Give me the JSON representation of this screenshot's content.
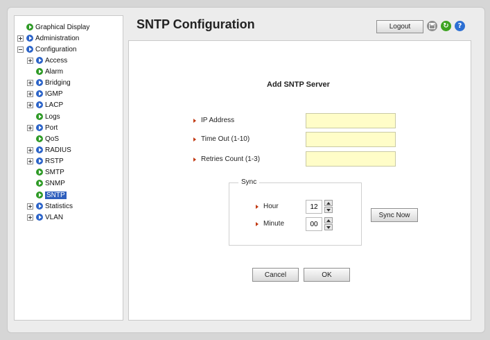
{
  "page": {
    "title": "SNTP Configuration"
  },
  "header": {
    "logout_label": "Logout",
    "icons": [
      "save-icon",
      "refresh-icon",
      "help-icon"
    ],
    "refresh_glyph": "↻",
    "help_glyph": "?"
  },
  "sidebar": {
    "items": [
      {
        "label": "Graphical Display"
      },
      {
        "label": "Administration"
      },
      {
        "label": "Configuration"
      },
      {
        "label": "Access"
      },
      {
        "label": "Alarm"
      },
      {
        "label": "Bridging"
      },
      {
        "label": "IGMP"
      },
      {
        "label": "LACP"
      },
      {
        "label": "Logs"
      },
      {
        "label": "Port"
      },
      {
        "label": "QoS"
      },
      {
        "label": "RADIUS"
      },
      {
        "label": "RSTP"
      },
      {
        "label": "SMTP"
      },
      {
        "label": "SNMP"
      },
      {
        "label": "SNTP",
        "selected": true
      },
      {
        "label": "Statistics"
      },
      {
        "label": "VLAN"
      }
    ]
  },
  "form": {
    "section_title": "Add SNTP Server",
    "ip_address_label": "IP Address",
    "ip_address_value": "",
    "timeout_label": "Time Out (1-10)",
    "timeout_value": "",
    "retries_label": "Retries Count (1-3)",
    "retries_value": "",
    "sync": {
      "legend": "Sync",
      "hour_label": "Hour",
      "hour_value": "12",
      "minute_label": "Minute",
      "minute_value": "00",
      "sync_now_label": "Sync Now"
    },
    "cancel_label": "Cancel",
    "ok_label": "OK"
  },
  "colors": {
    "selected_bg": "#2f5fbd",
    "input_yellow": "#fffdc8",
    "arrow_red": "#c23a12",
    "node_blue": "#2b63c8",
    "node_green": "#2e9a26"
  }
}
